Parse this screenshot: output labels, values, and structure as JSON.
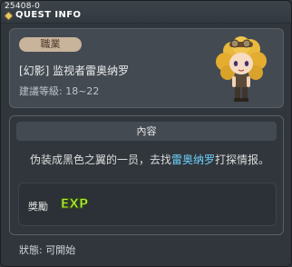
{
  "header": {
    "quest_id": "25408-0",
    "title": "QUEST INFO"
  },
  "card": {
    "job_label": "職業",
    "quest_name": "[幻影] 监视者雷奥纳罗",
    "level_text": "建議等級: 18~22"
  },
  "content": {
    "header": "內容",
    "desc_before": "伪装成黑色之翼的一员，去找",
    "desc_npc": "雷奥纳罗",
    "desc_after": "打探情报。",
    "npc_color": "#6fd2ff"
  },
  "reward": {
    "label": "獎勵",
    "icon": "exp-icon",
    "text": "EXP"
  },
  "status": {
    "text": "狀態:  可開始"
  }
}
